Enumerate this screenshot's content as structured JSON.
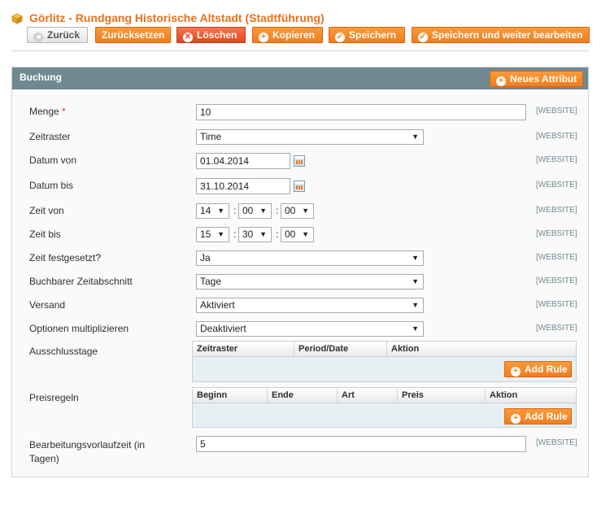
{
  "page": {
    "title": "Görlitz - Rundgang Historische Altstadt (Stadtführung)",
    "title_icon": "box-icon"
  },
  "toolbar": {
    "back": "Zurück",
    "reset": "Zurücksetzen",
    "delete": "Löschen",
    "copy": "Kopieren",
    "save": "Speichern",
    "save_continue": "Speichern und weiter bearbeiten"
  },
  "panel": {
    "title": "Buchung",
    "new_attribute": "Neues Attribut"
  },
  "scope_label": "[WEBSITE]",
  "fields": {
    "menge": {
      "label": "Menge",
      "required": "*",
      "value": "10"
    },
    "zeitraster": {
      "label": "Zeitraster",
      "value": "Time"
    },
    "datum_von": {
      "label": "Datum von",
      "value": "01.04.2014"
    },
    "datum_bis": {
      "label": "Datum bis",
      "value": "31.10.2014"
    },
    "zeit_von": {
      "label": "Zeit von",
      "hour": "14",
      "minute": "00",
      "second": "00"
    },
    "zeit_bis": {
      "label": "Zeit bis",
      "hour": "15",
      "minute": "30",
      "second": "00"
    },
    "zeit_fest": {
      "label": "Zeit festgesetzt?",
      "value": "Ja"
    },
    "zeitabschnitt": {
      "label": "Buchbarer Zeitabschnitt",
      "value": "Tage"
    },
    "versand": {
      "label": "Versand",
      "value": "Aktiviert"
    },
    "optionen": {
      "label": "Optionen multiplizieren",
      "value": "Deaktiviert"
    },
    "ausschlusstage": {
      "label": "Ausschlusstage",
      "columns": [
        "Zeitraster",
        "Period/Date",
        "Aktion"
      ],
      "add_rule": "Add Rule"
    },
    "preisregeln": {
      "label": "Preisregeln",
      "columns": [
        "Beginn",
        "Ende",
        "Art",
        "Preis",
        "Aktion"
      ],
      "add_rule": "Add Rule"
    },
    "vorlaufzeit": {
      "label": "Bearbeitungsvorlaufzeit (in Tagen)",
      "value": "5"
    }
  },
  "colors": {
    "accent": "#f07d1e",
    "panel_header": "#6f8992",
    "title": "#e8721b"
  }
}
